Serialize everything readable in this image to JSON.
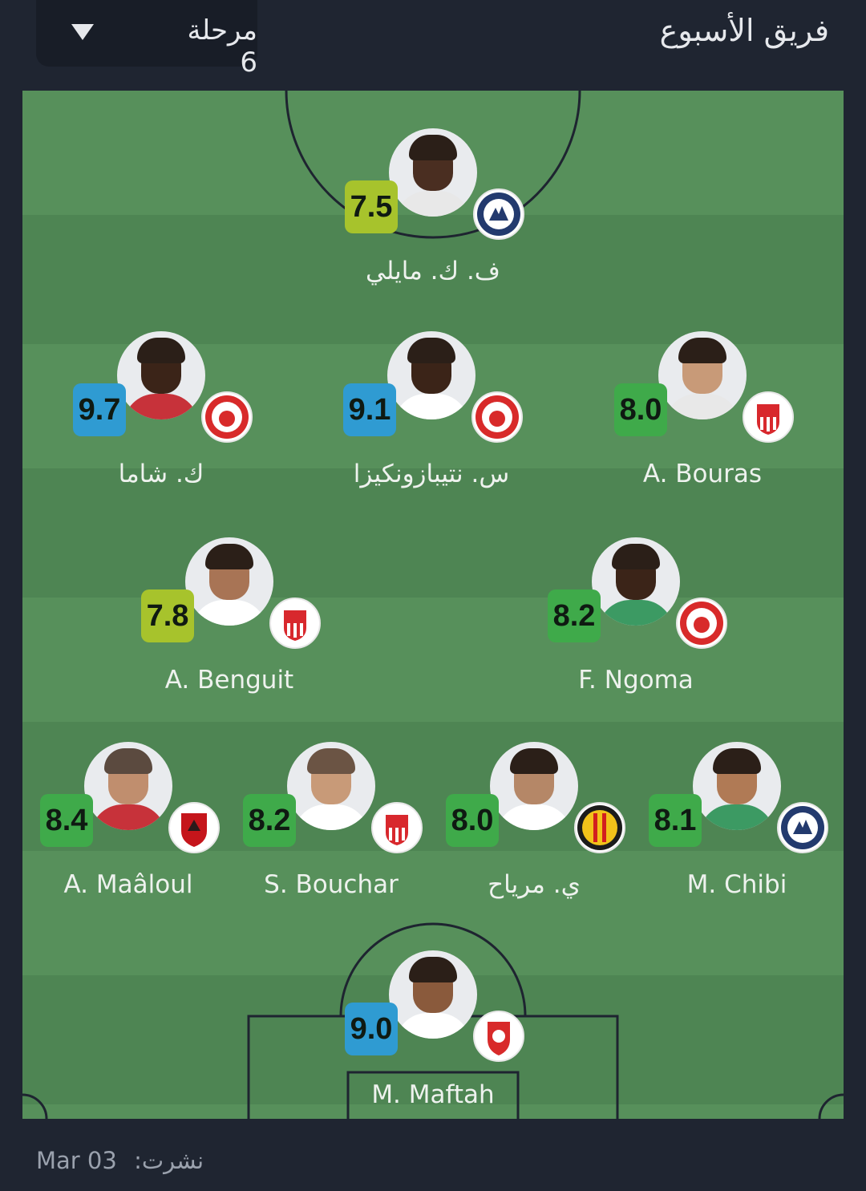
{
  "header": {
    "title": "فريق الأسبوع",
    "round_label": "مرحلة 6"
  },
  "colors": {
    "rating_yellow": "#a7c32c",
    "rating_blue": "#2f9bd2",
    "rating_green": "#3faa4a"
  },
  "players": [
    {
      "name": "ف. ك. مايلي",
      "rating": "7.5",
      "club_icon": "pyramids-badge-icon"
    },
    {
      "name": "ك. شاما",
      "rating": "9.7",
      "club_icon": "simba-badge-icon"
    },
    {
      "name": "س. نتيبازونكيزا",
      "rating": "9.1",
      "club_icon": "simba-badge-icon"
    },
    {
      "name": "A. Bouras",
      "rating": "8.0",
      "club_icon": "crb-badge-icon"
    },
    {
      "name": "A. Benguit",
      "rating": "7.8",
      "club_icon": "crb-badge-icon"
    },
    {
      "name": "F. Ngoma",
      "rating": "8.2",
      "club_icon": "simba-badge-icon"
    },
    {
      "name": "A. Maâloul",
      "rating": "8.4",
      "club_icon": "al-ahly-badge-icon"
    },
    {
      "name": "S. Bouchar",
      "rating": "8.2",
      "club_icon": "crb-badge-icon"
    },
    {
      "name": "ي. مرياح",
      "rating": "8.0",
      "club_icon": "esperance-badge-icon"
    },
    {
      "name": "M. Chibi",
      "rating": "8.1",
      "club_icon": "pyramids-badge-icon"
    },
    {
      "name": "M. Maftah",
      "rating": "9.0",
      "club_icon": "wydad-badge-icon"
    }
  ],
  "footer": {
    "published_label": "نشرت:",
    "date": "Mar 03"
  }
}
